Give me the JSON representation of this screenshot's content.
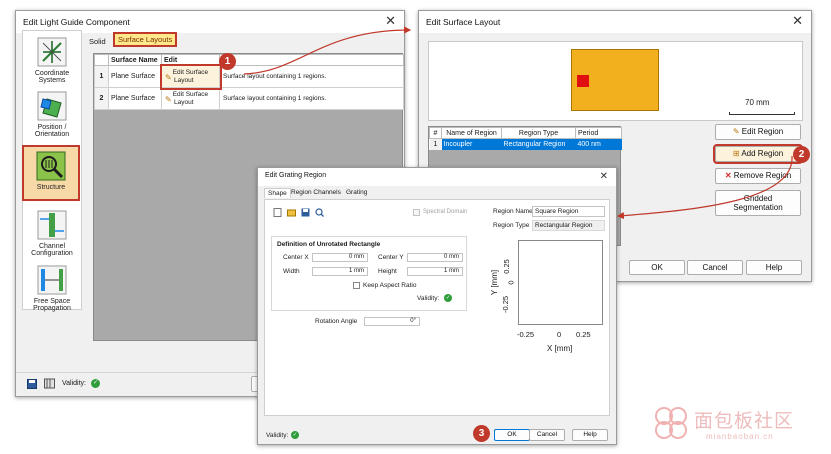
{
  "light_guide": {
    "title": "Edit Light Guide Component",
    "sidebar": [
      {
        "label_l1": "Coordinate",
        "label_l2": "Systems"
      },
      {
        "label_l1": "Position /",
        "label_l2": "Orientation"
      },
      {
        "label_l1": "Structure",
        "label_l2": ""
      },
      {
        "label_l1": "Channel",
        "label_l2": "Configuration"
      },
      {
        "label_l1": "Free Space",
        "label_l2": "Propagation"
      }
    ],
    "tabs": [
      "Solid",
      "Surface Layouts"
    ],
    "table_headers": [
      "Surface Name",
      "Edit"
    ],
    "rows": [
      {
        "num": "1",
        "name": "Plane Surface",
        "edit_l1": "Edit Surface",
        "edit_l2": "Layout",
        "desc": "Surface layout containing 1 regions."
      },
      {
        "num": "2",
        "name": "Plane Surface",
        "edit_l1": "Edit Surface",
        "edit_l2": "Layout",
        "desc": "Surface layout containing 1 regions."
      }
    ],
    "validity_label": "Validity:"
  },
  "surface_layout": {
    "title": "Edit Surface Layout",
    "scale_label": "70 mm",
    "table_headers": [
      "#",
      "Name of Region",
      "Region Type",
      "Period"
    ],
    "rows": [
      {
        "num": "1",
        "name": "Incoupler",
        "type": "Rectangular Region",
        "period": "400 nm"
      }
    ],
    "buttons": {
      "edit_region": "Edit Region",
      "add_region": "Add Region",
      "remove_region": "Remove Region",
      "gridded_l1": "Gridded",
      "gridded_l2": "Segmentation",
      "ok": "OK",
      "cancel": "Cancel",
      "help": "Help"
    }
  },
  "grating_region": {
    "title": "Edit Grating Region",
    "tabs": [
      "Shape",
      "Region Channels",
      "Grating"
    ],
    "spectral_domain_label": "Spectral Domain",
    "region_name_label": "Region Name",
    "region_name_value": "Square Region",
    "region_type_label": "Region Type",
    "region_type_value": "Rectangular Region",
    "definition_title": "Definition of Unrotated Rectangle",
    "center_x_label": "Center X",
    "center_x_value": "0 mm",
    "center_y_label": "Center Y",
    "center_y_value": "0 mm",
    "width_label": "Width",
    "width_value": "1 mm",
    "height_label": "Height",
    "height_value": "1 mm",
    "keep_aspect_label": "Keep Aspect Ratio",
    "validity_label": "Validity:",
    "rotation_label": "Rotation Angle",
    "rotation_value": "0°",
    "plot": {
      "xlabel": "X [mm]",
      "ylabel": "Y [mm]",
      "xticks": [
        "-0.25",
        "0",
        "0.25"
      ],
      "yticks": [
        "-0.25",
        "0",
        "0.25"
      ]
    },
    "buttons": {
      "ok": "OK",
      "cancel": "Cancel",
      "help": "Help"
    }
  },
  "callouts": [
    "1",
    "2",
    "3"
  ],
  "watermark": {
    "text": "面包板社区",
    "url": "mianbaoban.cn"
  },
  "colors": {
    "accent_red": "#c0392b",
    "selection_blue": "#0078d7",
    "layout_orange": "#f2b01e",
    "region_red": "#e01010",
    "tab_yellow": "#ffe98a"
  }
}
